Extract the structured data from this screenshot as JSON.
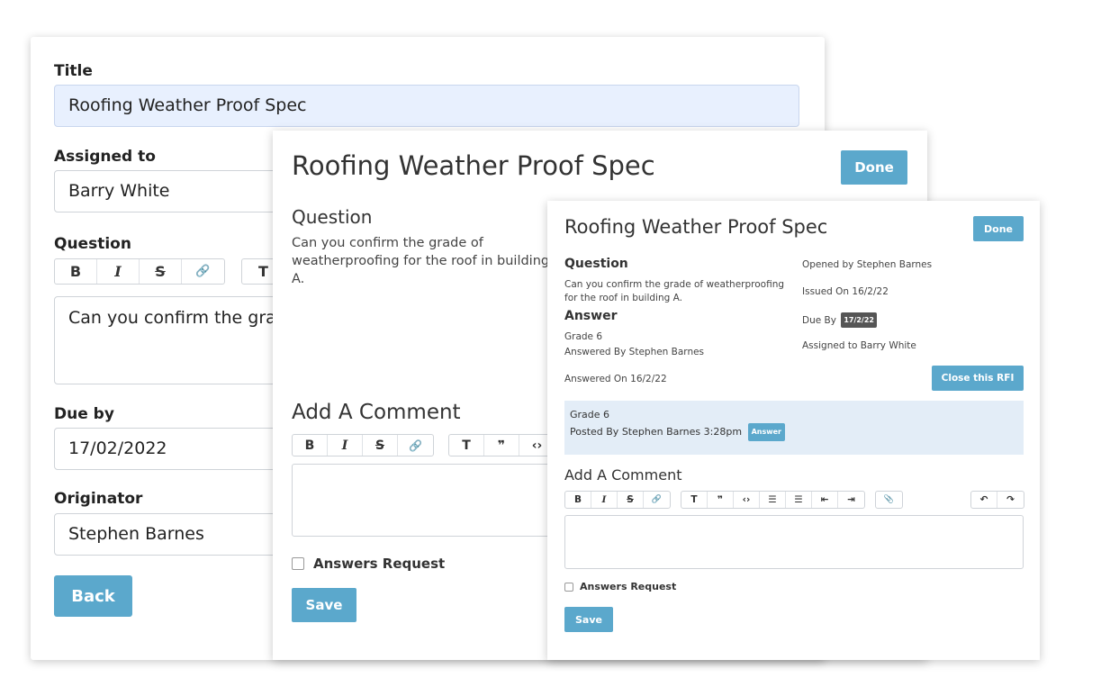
{
  "form": {
    "title_label": "Title",
    "title_value": "Roofing Weather Proof Spec",
    "assigned_label": "Assigned to",
    "assigned_value": "Barry White",
    "question_label": "Question",
    "question_value": "Can you confirm the grade of weatherproofing for the roof in building A.",
    "due_label": "Due by",
    "due_value": "17/02/2022",
    "originator_label": "Originator",
    "originator_value": "Stephen Barnes",
    "back_label": "Back"
  },
  "toolbar": {
    "bold": "B",
    "italic": "I",
    "strike": "S",
    "link": "🔗",
    "heading": "T",
    "quote": "❞",
    "code": "‹›",
    "bullets": "☰",
    "numbers": "☰",
    "outdent": "⇤",
    "indent": "⇥",
    "attach": "📎",
    "undo": "↶",
    "redo": "↷"
  },
  "detail": {
    "title": "Roofing Weather Proof Spec",
    "done_label": "Done",
    "question_heading": "Question",
    "question_text": "Can you confirm the grade of weatherproofing for the roof in building A.",
    "answer_heading": "Answer",
    "answer_text": "Grade 6",
    "answered_by": "Answered By Stephen Barnes",
    "answered_on": "Answered On 16/2/22",
    "opened_by": "Opened by Stephen Barnes",
    "issued_on": "Issued On 16/2/22",
    "due_by_label": "Due By",
    "due_by_badge": "17/2/22",
    "assigned_to": "Assigned to Barry White",
    "close_rfi_label": "Close this RFI",
    "post_text": "Grade 6",
    "post_meta": "Posted By Stephen Barnes 3:28pm",
    "post_badge": "Answer",
    "add_comment_heading": "Add A Comment",
    "answers_request_label": "Answers Request",
    "save_label": "Save"
  }
}
